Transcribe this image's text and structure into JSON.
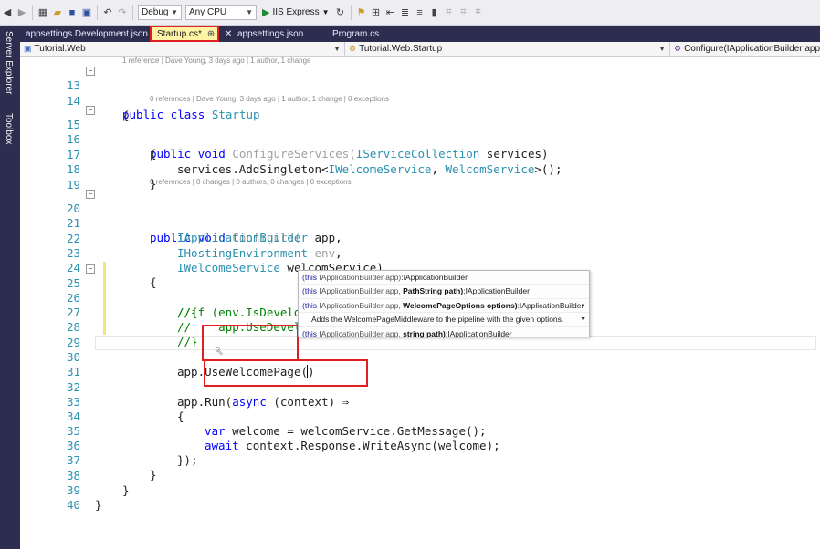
{
  "toolbar": {
    "config": "Debug",
    "platform": "Any CPU",
    "run_label": "IIS Express"
  },
  "sidebar": {
    "server_explorer": "Server Explorer",
    "toolbox": "Toolbox"
  },
  "tabs": [
    {
      "label": "appsettings.Development.json"
    },
    {
      "label": "Startup.cs*"
    },
    {
      "label": "appsettings.json"
    },
    {
      "label": "Program.cs"
    }
  ],
  "nav": {
    "project": "Tutorial.Web",
    "type": "Tutorial.Web.Startup",
    "member": "Configure(IApplicationBuilder app, IHost"
  },
  "codelens": {
    "class": "1 reference | Dave Young, 3 days ago | 1 author, 1 change",
    "configure_services": "0 references | Dave Young, 3 days ago | 1 author, 1 change | 0 exceptions",
    "configure": "0 references | 0 changes | 0 authors, 0 changes | 0 exceptions"
  },
  "code": {
    "l13a": "public class",
    "l13b": "Startup",
    "l15a": "public void",
    "l15b": "ConfigureServices(",
    "l15c": "IServiceCollection",
    "l15d": " services)",
    "l17a": "services.AddSingleton<",
    "l17b": "IWelcomeService",
    "l17c": ", ",
    "l17d": "WelcomService",
    "l17e": ">();",
    "l20a": "public void",
    "l20b": "Configure(",
    "l21a": "IApplicationBuilder",
    "l21b": " app,",
    "l22a": "IHostingEnvironment",
    "l22b": " env",
    "l22c": ",",
    "l23a": "IWelcomeService",
    "l23b": " welcomService)",
    "l25": "//if (env.IsDevelopment())",
    "l26": "//{",
    "l27": "//    app.UseDevel",
    "l28": "//}",
    "l30a": "app.",
    "l30b": "UseWelcomePage(",
    "l32a": "app.",
    "l32b": "Run(",
    "l32c": "async",
    "l32d": " (context) ⇒",
    "l34a": "var",
    "l34b": " welcome = welcomService.GetMessage();",
    "l35a": "await",
    "l35b": " context.Response.WriteAsync(welcome);",
    "l36": "});"
  },
  "intellisense": {
    "r1a": "(this",
    "r1b": " IApplicationBuilder app)",
    "r1c": ":IApplicationBuilder",
    "r2a": "(this",
    "r2b": " IApplicationBuilder app, ",
    "r2c": "PathString path)",
    "r2d": ":IApplicationBuilder",
    "r3a": "(this",
    "r3b": " IApplicationBuilder app, ",
    "r3c": "WelcomePageOptions options)",
    "r3d": ":IApplicationBuilder",
    "r4": "Adds the WelcomePageMiddleware to the pipeline with the given options.",
    "r5a": "(this",
    "r5b": " IApplicationBuilder app, ",
    "r5c": "string path)",
    "r5d": ":IApplicationBuilder"
  }
}
